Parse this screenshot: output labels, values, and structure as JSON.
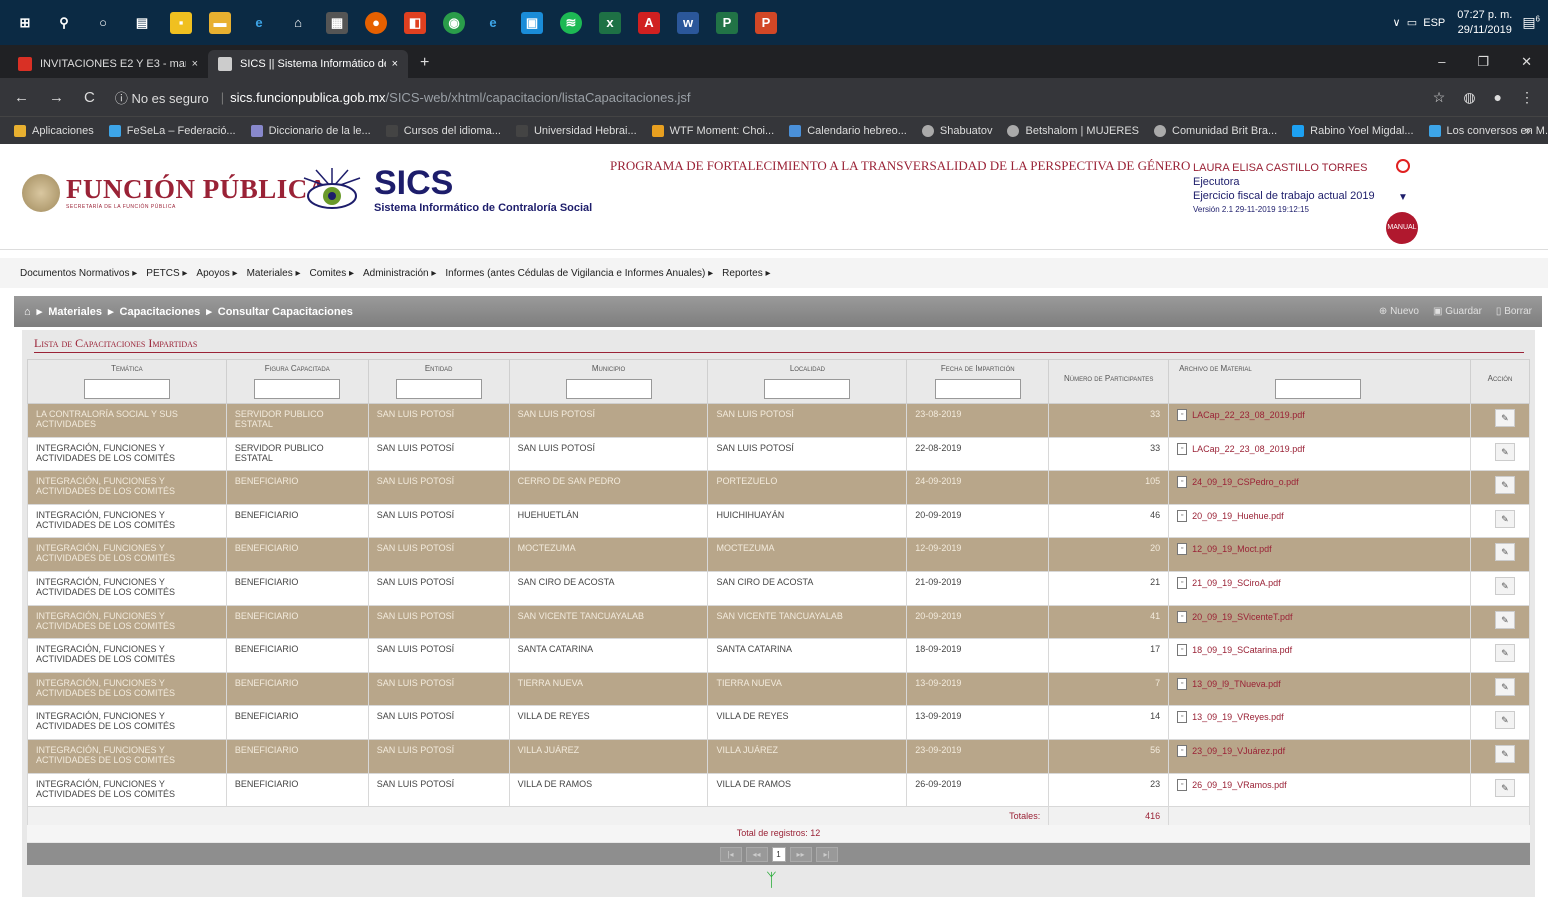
{
  "taskbar": {
    "lang": "ESP",
    "time": "07:27 p. m.",
    "date": "29/11/2019",
    "notif": "6"
  },
  "tabs": [
    {
      "title": "INVITACIONES E2 Y E3 - marcolin",
      "close": "×"
    },
    {
      "title": "SICS || Sistema Informático de Co",
      "close": "×"
    }
  ],
  "newtab": "+",
  "address": {
    "security": "ⓘ No es seguro",
    "host": "sics.funcionpublica.gob.mx",
    "path": "/SICS-web/xhtml/capacitacion/listaCapacitaciones.jsf"
  },
  "bookmarks": [
    "Aplicaciones",
    "FeSeLa – Federació...",
    "Diccionario de la le...",
    "Cursos del idioma...",
    "Universidad Hebrai...",
    "WTF Moment: Choi...",
    "Calendario hebreo...",
    "Shabuatov",
    "Betshalom | MUJERES",
    "Comunidad Brit Bra...",
    "Rabino Yoel Migdal...",
    "Los conversos en M...",
    "»"
  ],
  "header": {
    "org": "FUNCIÓN PÚBLICA",
    "org_sub": "SECRETARÍA DE LA FUNCIÓN PÚBLICA",
    "app": "SICS",
    "app_sub": "Sistema Informático de Contraloría Social",
    "program": "PROGRAMA DE FORTALECIMIENTO A LA TRANSVERSALIDAD DE LA PERSPECTIVA DE GÉNERO",
    "user_name": "LAURA ELISA CASTILLO TORRES",
    "role": "Ejecutora",
    "fiscal": "Ejercicio fiscal de trabajo actual  2019",
    "version": "Versión 2.1   29-11-2019 19:12:15",
    "manual": "MANUAL"
  },
  "menu": [
    "Documentos Normativos ▸",
    "PETCS ▸",
    "Apoyos ▸",
    "Materiales ▸",
    "Comites ▸",
    "Administración ▸",
    "Informes (antes Cédulas de Vigilancia e Informes Anuales) ▸",
    "Reportes ▸"
  ],
  "breadcrumb": {
    "home": "⌂",
    "items": [
      "Materiales",
      "Capacitaciones",
      "Consultar Capacitaciones"
    ],
    "buttons": [
      "Nuevo",
      "Guardar",
      "Borrar"
    ]
  },
  "panel_title": "Lista de Capacitaciones Impartidas",
  "columns": [
    "Temática",
    "Figura Capacitada",
    "Entidad",
    "Municipio",
    "Localidad",
    "Fecha de Impartición",
    "Número de Participantes",
    "Archivo de Material",
    "Acción"
  ],
  "rows": [
    [
      "LA CONTRALORÍA SOCIAL Y SUS ACTIVIDADES",
      "SERVIDOR PUBLICO ESTATAL",
      "SAN LUIS POTOSÍ",
      "SAN LUIS POTOSÍ",
      "SAN LUIS POTOSÍ",
      "23-08-2019",
      "33",
      "LACap_22_23_08_2019.pdf"
    ],
    [
      "INTEGRACIÓN, FUNCIONES Y ACTIVIDADES DE LOS COMITÉS",
      "SERVIDOR PUBLICO ESTATAL",
      "SAN LUIS POTOSÍ",
      "SAN LUIS POTOSÍ",
      "SAN LUIS POTOSÍ",
      "22-08-2019",
      "33",
      "LACap_22_23_08_2019.pdf"
    ],
    [
      "INTEGRACIÓN, FUNCIONES Y ACTIVIDADES DE LOS COMITÉS",
      "BENEFICIARIO",
      "SAN LUIS POTOSÍ",
      "CERRO DE SAN PEDRO",
      "PORTEZUELO",
      "24-09-2019",
      "105",
      "24_09_19_CSPedro_o.pdf"
    ],
    [
      "INTEGRACIÓN, FUNCIONES Y ACTIVIDADES DE LOS COMITÉS",
      "BENEFICIARIO",
      "SAN LUIS POTOSÍ",
      "HUEHUETLÁN",
      "HUICHIHUAYÁN",
      "20-09-2019",
      "46",
      "20_09_19_Huehue.pdf"
    ],
    [
      "INTEGRACIÓN, FUNCIONES Y ACTIVIDADES DE LOS COMITÉS",
      "BENEFICIARIO",
      "SAN LUIS POTOSÍ",
      "MOCTEZUMA",
      "MOCTEZUMA",
      "12-09-2019",
      "20",
      "12_09_19_Moct.pdf"
    ],
    [
      "INTEGRACIÓN, FUNCIONES Y ACTIVIDADES DE LOS COMITÉS",
      "BENEFICIARIO",
      "SAN LUIS POTOSÍ",
      "SAN CIRO DE ACOSTA",
      "SAN CIRO DE ACOSTA",
      "21-09-2019",
      "21",
      "21_09_19_SCiroA.pdf"
    ],
    [
      "INTEGRACIÓN, FUNCIONES Y ACTIVIDADES DE LOS COMITÉS",
      "BENEFICIARIO",
      "SAN LUIS POTOSÍ",
      "SAN VICENTE TANCUAYALAB",
      "SAN VICENTE TANCUAYALAB",
      "20-09-2019",
      "41",
      "20_09_19_SVicenteT.pdf"
    ],
    [
      "INTEGRACIÓN, FUNCIONES Y ACTIVIDADES DE LOS COMITÉS",
      "BENEFICIARIO",
      "SAN LUIS POTOSÍ",
      "SANTA CATARINA",
      "SANTA CATARINA",
      "18-09-2019",
      "17",
      "18_09_19_SCatarina.pdf"
    ],
    [
      "INTEGRACIÓN, FUNCIONES Y ACTIVIDADES DE LOS COMITÉS",
      "BENEFICIARIO",
      "SAN LUIS POTOSÍ",
      "TIERRA NUEVA",
      "TIERRA NUEVA",
      "13-09-2019",
      "7",
      "13_09_l9_TNueva.pdf"
    ],
    [
      "INTEGRACIÓN, FUNCIONES Y ACTIVIDADES DE LOS COMITÉS",
      "BENEFICIARIO",
      "SAN LUIS POTOSÍ",
      "VILLA DE REYES",
      "VILLA DE REYES",
      "13-09-2019",
      "14",
      "13_09_19_VReyes.pdf"
    ],
    [
      "INTEGRACIÓN, FUNCIONES Y ACTIVIDADES DE LOS COMITÉS",
      "BENEFICIARIO",
      "SAN LUIS POTOSÍ",
      "VILLA JUÁREZ",
      "VILLA JUÁREZ",
      "23-09-2019",
      "56",
      "23_09_19_VJuárez.pdf"
    ],
    [
      "INTEGRACIÓN, FUNCIONES Y ACTIVIDADES DE LOS COMITÉS",
      "BENEFICIARIO",
      "SAN LUIS POTOSÍ",
      "VILLA DE RAMOS",
      "VILLA DE RAMOS",
      "26-09-2019",
      "23",
      "26_09_19_VRamos.pdf"
    ]
  ],
  "totals_label": "Totales:",
  "totals_value": "416",
  "total_records": "Total de registros: 12",
  "pager": {
    "first": "|◂",
    "prev": "◂◂",
    "current": "1",
    "next": "▸▸",
    "last": "▸|"
  },
  "colors": {
    "brand": "#9a2236",
    "row_odd": "#b8a68a",
    "navy": "#1d1d6b"
  }
}
